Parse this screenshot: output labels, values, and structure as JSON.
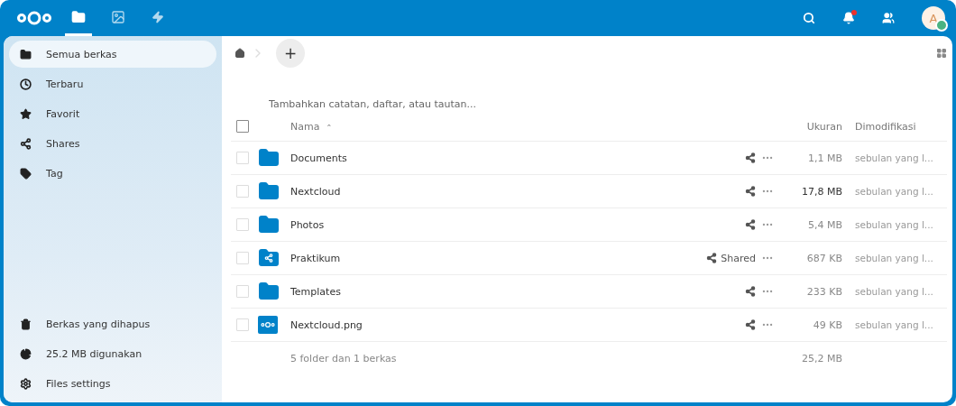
{
  "header": {
    "apps": [
      {
        "kind": "files",
        "selected": true
      },
      {
        "kind": "photos",
        "selected": false
      },
      {
        "kind": "activity",
        "selected": false
      }
    ],
    "avatar": {
      "initial": "A",
      "online": true
    },
    "notification_unread": true
  },
  "sidebar": {
    "items": [
      {
        "label": "Semua berkas",
        "selected": true
      },
      {
        "label": "Terbaru",
        "selected": false
      },
      {
        "label": "Favorit",
        "selected": false
      },
      {
        "label": "Shares",
        "selected": false
      },
      {
        "label": "Tag",
        "selected": false
      }
    ],
    "footer": [
      "Berkas yang dihapus",
      "25.2 MB digunakan",
      "Files settings"
    ]
  },
  "toolbar": {
    "new_button": "+"
  },
  "rich_workspace": {
    "placeholder": "Tambahkan catatan, daftar, atau tautan..."
  },
  "table": {
    "columns": {
      "name": "Nama",
      "sort_indicator": "⌃",
      "size": "Ukuran",
      "modified": "Dimodifikasi"
    },
    "select_all_checked": false,
    "rows": [
      {
        "kind": "folder",
        "name": "Documents",
        "size": "1,1 MB",
        "modified": "sebulan yang l...",
        "checked": false
      },
      {
        "kind": "folder",
        "name": "Nextcloud",
        "size": "17,8 MB",
        "modified": "sebulan yang l...",
        "checked": false
      },
      {
        "kind": "folder",
        "name": "Photos",
        "size": "5,4 MB",
        "modified": "sebulan yang l...",
        "checked": false
      },
      {
        "kind": "shared-folder",
        "name": "Praktikum",
        "share_label": "Shared",
        "size": "687 KB",
        "modified": "sebulan yang l...",
        "checked": false
      },
      {
        "kind": "folder",
        "name": "Templates",
        "size": "233 KB",
        "modified": "sebulan yang l...",
        "checked": false
      },
      {
        "kind": "image",
        "name": "Nextcloud.png",
        "size": "49 KB",
        "modified": "sebulan yang l...",
        "checked": false
      }
    ],
    "summary": {
      "label": "5 folder dan 1 berkas",
      "size": "25,2 MB"
    }
  }
}
